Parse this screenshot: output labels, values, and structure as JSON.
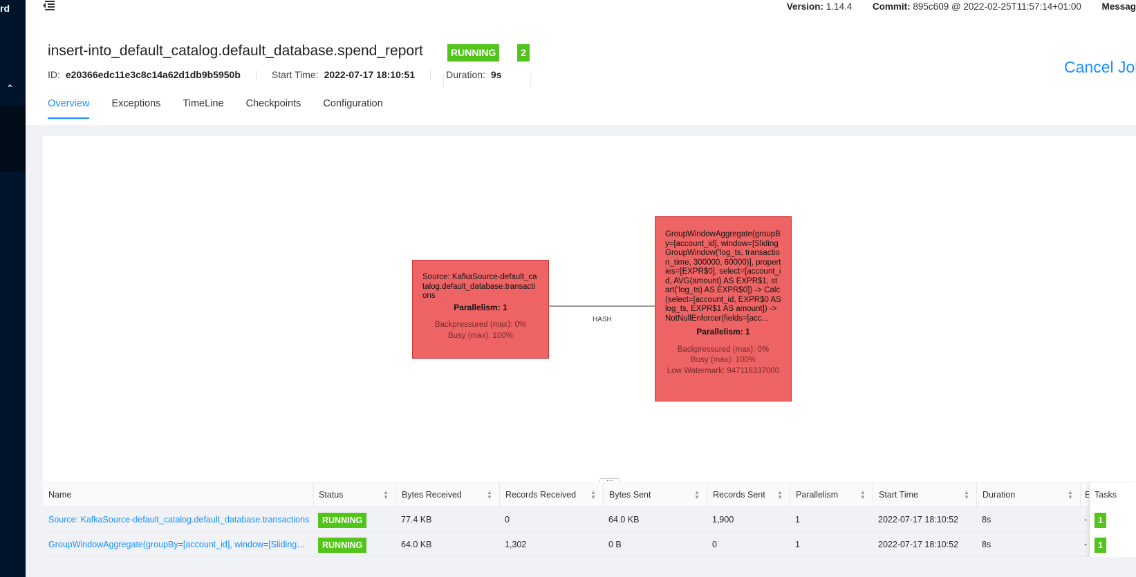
{
  "app": {
    "brand": "rd"
  },
  "header": {
    "version_label": "Version:",
    "version": "1.14.4",
    "commit_label": "Commit:",
    "commit": "895c609 @ 2022-02-25T11:57:14+01:00",
    "messages_label": "Messag"
  },
  "job": {
    "name": "insert-into_default_catalog.default_database.spend_report",
    "state": "RUNNING",
    "task_count": "2",
    "id_label": "ID:",
    "id": "e20366edc11e3c8c14a62d1db9b5950b",
    "start_time_label": "Start Time:",
    "start_time": "2022-07-17 18:10:51",
    "duration_label": "Duration:",
    "duration": "9s",
    "cancel_label": "Cancel Jol"
  },
  "tabs": [
    {
      "label": "Overview",
      "active": true
    },
    {
      "label": "Exceptions"
    },
    {
      "label": "TimeLine"
    },
    {
      "label": "Checkpoints"
    },
    {
      "label": "Configuration"
    }
  ],
  "graph": {
    "nodes": [
      {
        "description": "Source: KafkaSource-default_catalog.default_database.transactions",
        "parallelism": "Parallelism: 1",
        "backpressured": "Backpressured (max): 0%",
        "busy": "Busy (max): 100%"
      },
      {
        "description": "GroupWindowAggregate(groupBy=[account_id], window=[SlidingGroupWindow('log_ts, transaction_time, 300000, 60000)], properties=[EXPR$0], select=[account_id, AVG(amount) AS EXPR$1, start('log_ts) AS EXPR$0]) -> Calc(select=[account_id, EXPR$0 AS log_ts, EXPR$1 AS amount]) -> NotNullEnforcer(fields=[acc...",
        "parallelism": "Parallelism: 1",
        "backpressured": "Backpressured (max): 0%",
        "busy": "Busy (max): 100%",
        "watermark": "Low Watermark: 947116337000"
      }
    ],
    "edge_label": "HASH"
  },
  "table": {
    "columns": [
      "Name",
      "Status",
      "Bytes Received",
      "Records Received",
      "Bytes Sent",
      "Records Sent",
      "Parallelism",
      "Start Time",
      "Duration",
      "E",
      "Tasks"
    ],
    "rows": [
      {
        "name": "Source: KafkaSource-default_catalog.default_database.transactions",
        "status": "RUNNING",
        "bytes_received": "77.4 KB",
        "records_received": "0",
        "bytes_sent": "64.0 KB",
        "records_sent": "1,900",
        "parallelism": "1",
        "start_time": "2022-07-17 18:10:52",
        "duration": "8s",
        "end": "-",
        "tasks": "1"
      },
      {
        "name": "GroupWindowAggregate(groupBy=[account_id], window=[SlidingGro...",
        "status": "RUNNING",
        "bytes_received": "64.0 KB",
        "records_received": "1,302",
        "bytes_sent": "0 B",
        "records_sent": "0",
        "parallelism": "1",
        "start_time": "2022-07-17 18:10:52",
        "duration": "8s",
        "end": "-",
        "tasks": "1"
      }
    ]
  },
  "colors": {
    "accent": "#1890ff",
    "running": "#52c41a",
    "node_fill": "#ee6464",
    "sidebar": "#001529"
  }
}
